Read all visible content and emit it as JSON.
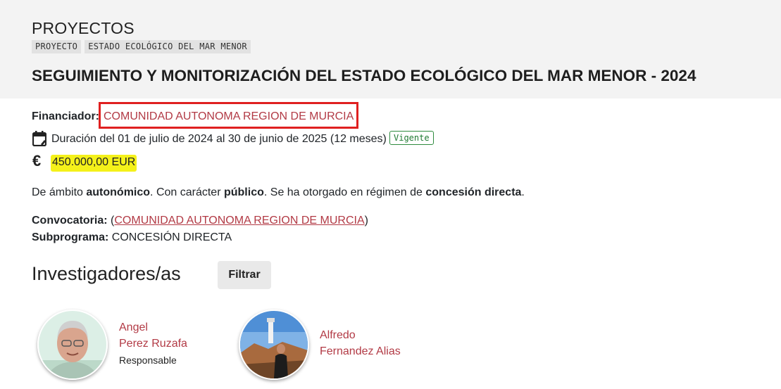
{
  "header": {
    "section_title": "PROYECTOS",
    "tags": [
      "PROYECTO",
      "ESTADO ECOLÓGICO DEL MAR MENOR"
    ],
    "title": "SEGUIMIENTO Y MONITORIZACIÓN DEL ESTADO ECOLÓGICO DEL MAR MENOR - 2024"
  },
  "details": {
    "funder_label": "Financiador:",
    "funder_value": "COMUNIDAD AUTONOMA REGION DE MURCIA",
    "duration": "Duración del 01 de julio de 2024 al 30 de junio de 2025 (12 meses)",
    "status_badge": "Vigente",
    "currency_symbol": "€",
    "amount": "450.000,00 EUR",
    "ambit": {
      "p1": "De ámbito ",
      "b1": "autonómico",
      "p2": ". Con carácter ",
      "b2": "público",
      "p3": ". Se ha otorgado en régimen de ",
      "b3": "concesión directa",
      "p4": "."
    },
    "convocatoria_label": "Convocatoria:",
    "convocatoria_open": " (",
    "convocatoria_value": "COMUNIDAD AUTONOMA REGION DE MURCIA",
    "convocatoria_close": ")",
    "subprograma_label": "Subprograma:",
    "subprograma_value": " CONCESIÓN DIRECTA"
  },
  "researchers": {
    "title": "Investigadores/as",
    "filter_label": "Filtrar",
    "people": [
      {
        "first": "Angel",
        "last": "Perez Ruzafa",
        "role": "Responsable"
      },
      {
        "first": "Alfredo",
        "last": "Fernandez Alias",
        "role": ""
      }
    ]
  },
  "colors": {
    "link": "#b23a45",
    "highlight": "#f4f11a",
    "annotation_box": "#e02020",
    "badge": "#1f7a32"
  }
}
